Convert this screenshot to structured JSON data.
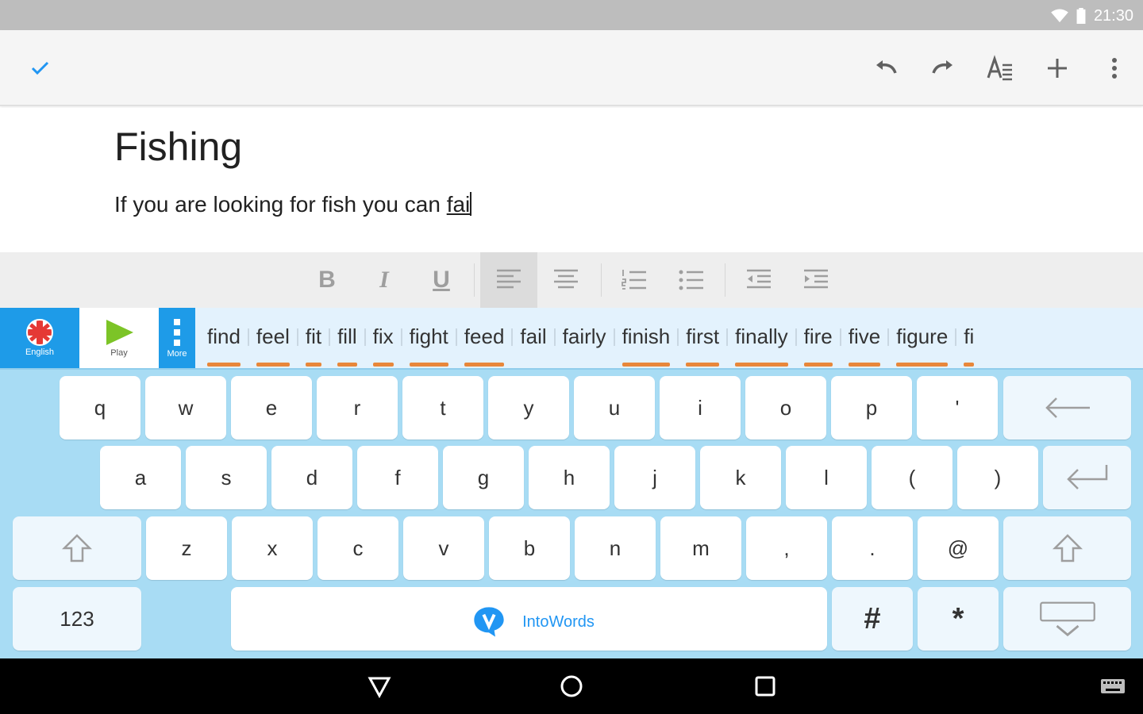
{
  "status_bar": {
    "time": "21:30",
    "icons": [
      "wifi-icon",
      "battery-icon"
    ]
  },
  "toolbar": {
    "icons": [
      "check-icon",
      "undo-icon",
      "redo-icon",
      "text-format-icon",
      "add-icon",
      "more-vert-icon"
    ]
  },
  "document": {
    "title": "Fishing",
    "body_text": "If you are looking for fish you can ",
    "typing_word": "fai"
  },
  "format_bar": {
    "bold_label": "B",
    "italic_label": "I",
    "underline_label": "U",
    "active": "align-left"
  },
  "suggestion_bar": {
    "language_label": "English",
    "play_label": "Play",
    "more_label": "More",
    "words": [
      {
        "text": "find",
        "marked": true
      },
      {
        "text": "feel",
        "marked": true
      },
      {
        "text": "fit",
        "marked": true
      },
      {
        "text": "fill",
        "marked": true
      },
      {
        "text": "fix",
        "marked": true
      },
      {
        "text": "fight",
        "marked": true
      },
      {
        "text": "feed",
        "marked": true
      },
      {
        "text": "fail",
        "marked": false
      },
      {
        "text": "fairly",
        "marked": false
      },
      {
        "text": "finish",
        "marked": true
      },
      {
        "text": "first",
        "marked": true
      },
      {
        "text": "finally",
        "marked": true
      },
      {
        "text": "fire",
        "marked": true
      },
      {
        "text": "five",
        "marked": true
      },
      {
        "text": "figure",
        "marked": true
      },
      {
        "text": "fi",
        "marked": true
      }
    ]
  },
  "keyboard": {
    "row1": [
      "q",
      "w",
      "e",
      "r",
      "t",
      "y",
      "u",
      "i",
      "o",
      "p",
      "'"
    ],
    "row2": [
      "a",
      "s",
      "d",
      "f",
      "g",
      "h",
      "j",
      "k",
      "l",
      "(",
      ")"
    ],
    "row3": [
      "z",
      "x",
      "c",
      "v",
      "b",
      "n",
      "m",
      ",",
      ".",
      "@"
    ],
    "numbers_label": "123",
    "hash_label": "#",
    "star_label": "*",
    "brand": "IntoWords",
    "accent": "#2196f3"
  },
  "colors": {
    "status_bar": "#bdbdbd",
    "keyboard_bg": "#a8dcf4",
    "suggestion_bg": "#e3f2fd",
    "underline_marker": "#e8873a",
    "tile_blue": "#1e9be8"
  }
}
